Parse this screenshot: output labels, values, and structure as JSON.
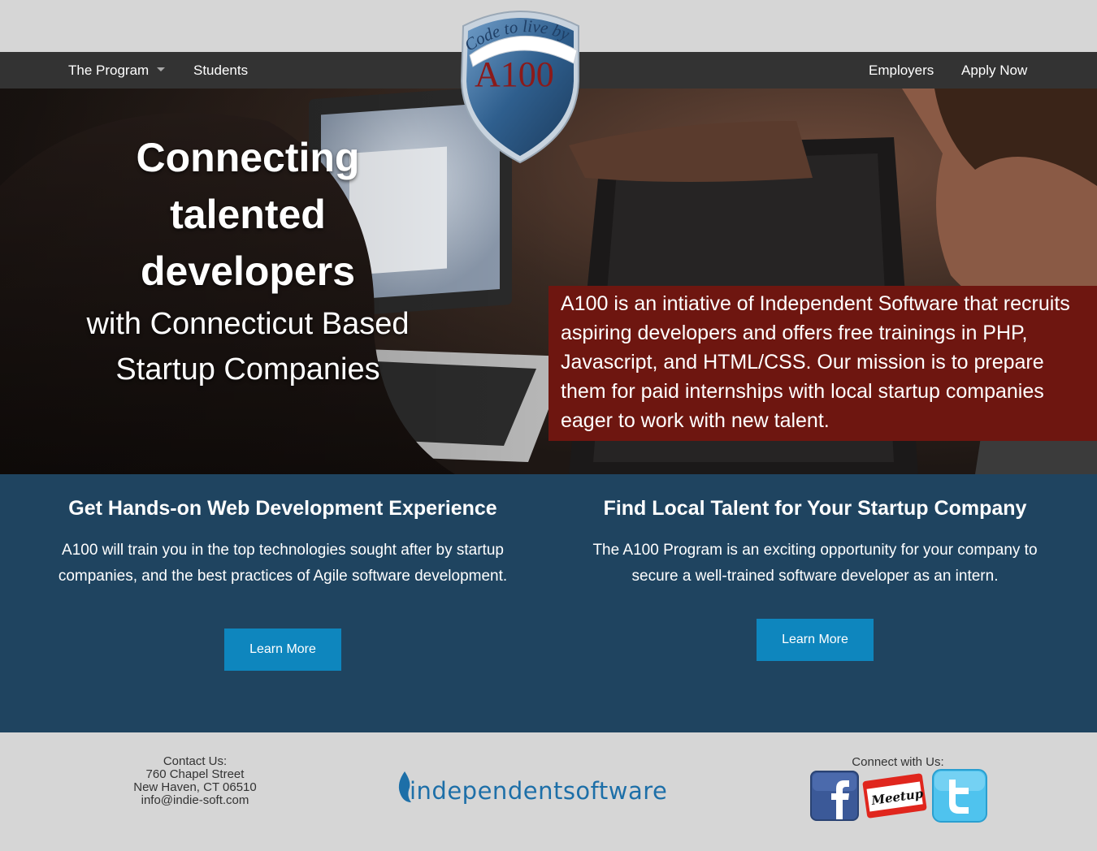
{
  "nav": {
    "program_label": "The Program",
    "students_label": "Students",
    "employers_label": "Employers",
    "apply_label": "Apply Now"
  },
  "logo": {
    "tagline": "Code to live by",
    "name": "A100"
  },
  "hero": {
    "headline_line1": "Connecting",
    "headline_line2": "talented",
    "headline_line3": "developers",
    "sub_line1": "with Connecticut Based",
    "sub_line2": "Startup Companies",
    "description": "A100 is an intiative of Independent Software that recruits aspiring developers and offers free trainings in PHP, Javascript, and HTML/CSS. Our mission is to prepare them for paid internships with local startup companies eager to work with new talent."
  },
  "features": {
    "left": {
      "title": "Get Hands-on Web Development Experience",
      "text": "A100 will train you in the top technologies sought after by startup companies, and the best practices of Agile software development.",
      "button": "Learn More"
    },
    "right": {
      "title": "Find Local Talent for Your Startup Company",
      "text": "The A100 Program is an exciting opportunity for your company to secure a well-trained software developer as an intern.",
      "button": "Learn More"
    }
  },
  "footer": {
    "contact_title": "Contact Us:",
    "address1": "760 Chapel Street",
    "address2": "New Haven, CT 06510",
    "email": "info@indie-soft.com",
    "company_logo_text": "independentsoftware",
    "connect_label": "Connect with Us:",
    "social": [
      "facebook-icon",
      "meetup-icon",
      "twitter-icon"
    ],
    "meetup_text": "Meetup"
  },
  "colors": {
    "navbar": "#333333",
    "hero_box": "#6e1610",
    "features_bg": "#1f4460",
    "button": "#0e86be",
    "footer_bg": "#d6d6d6",
    "shield_blue": "#2f5f8e",
    "logo_red": "#8b1a1a"
  }
}
